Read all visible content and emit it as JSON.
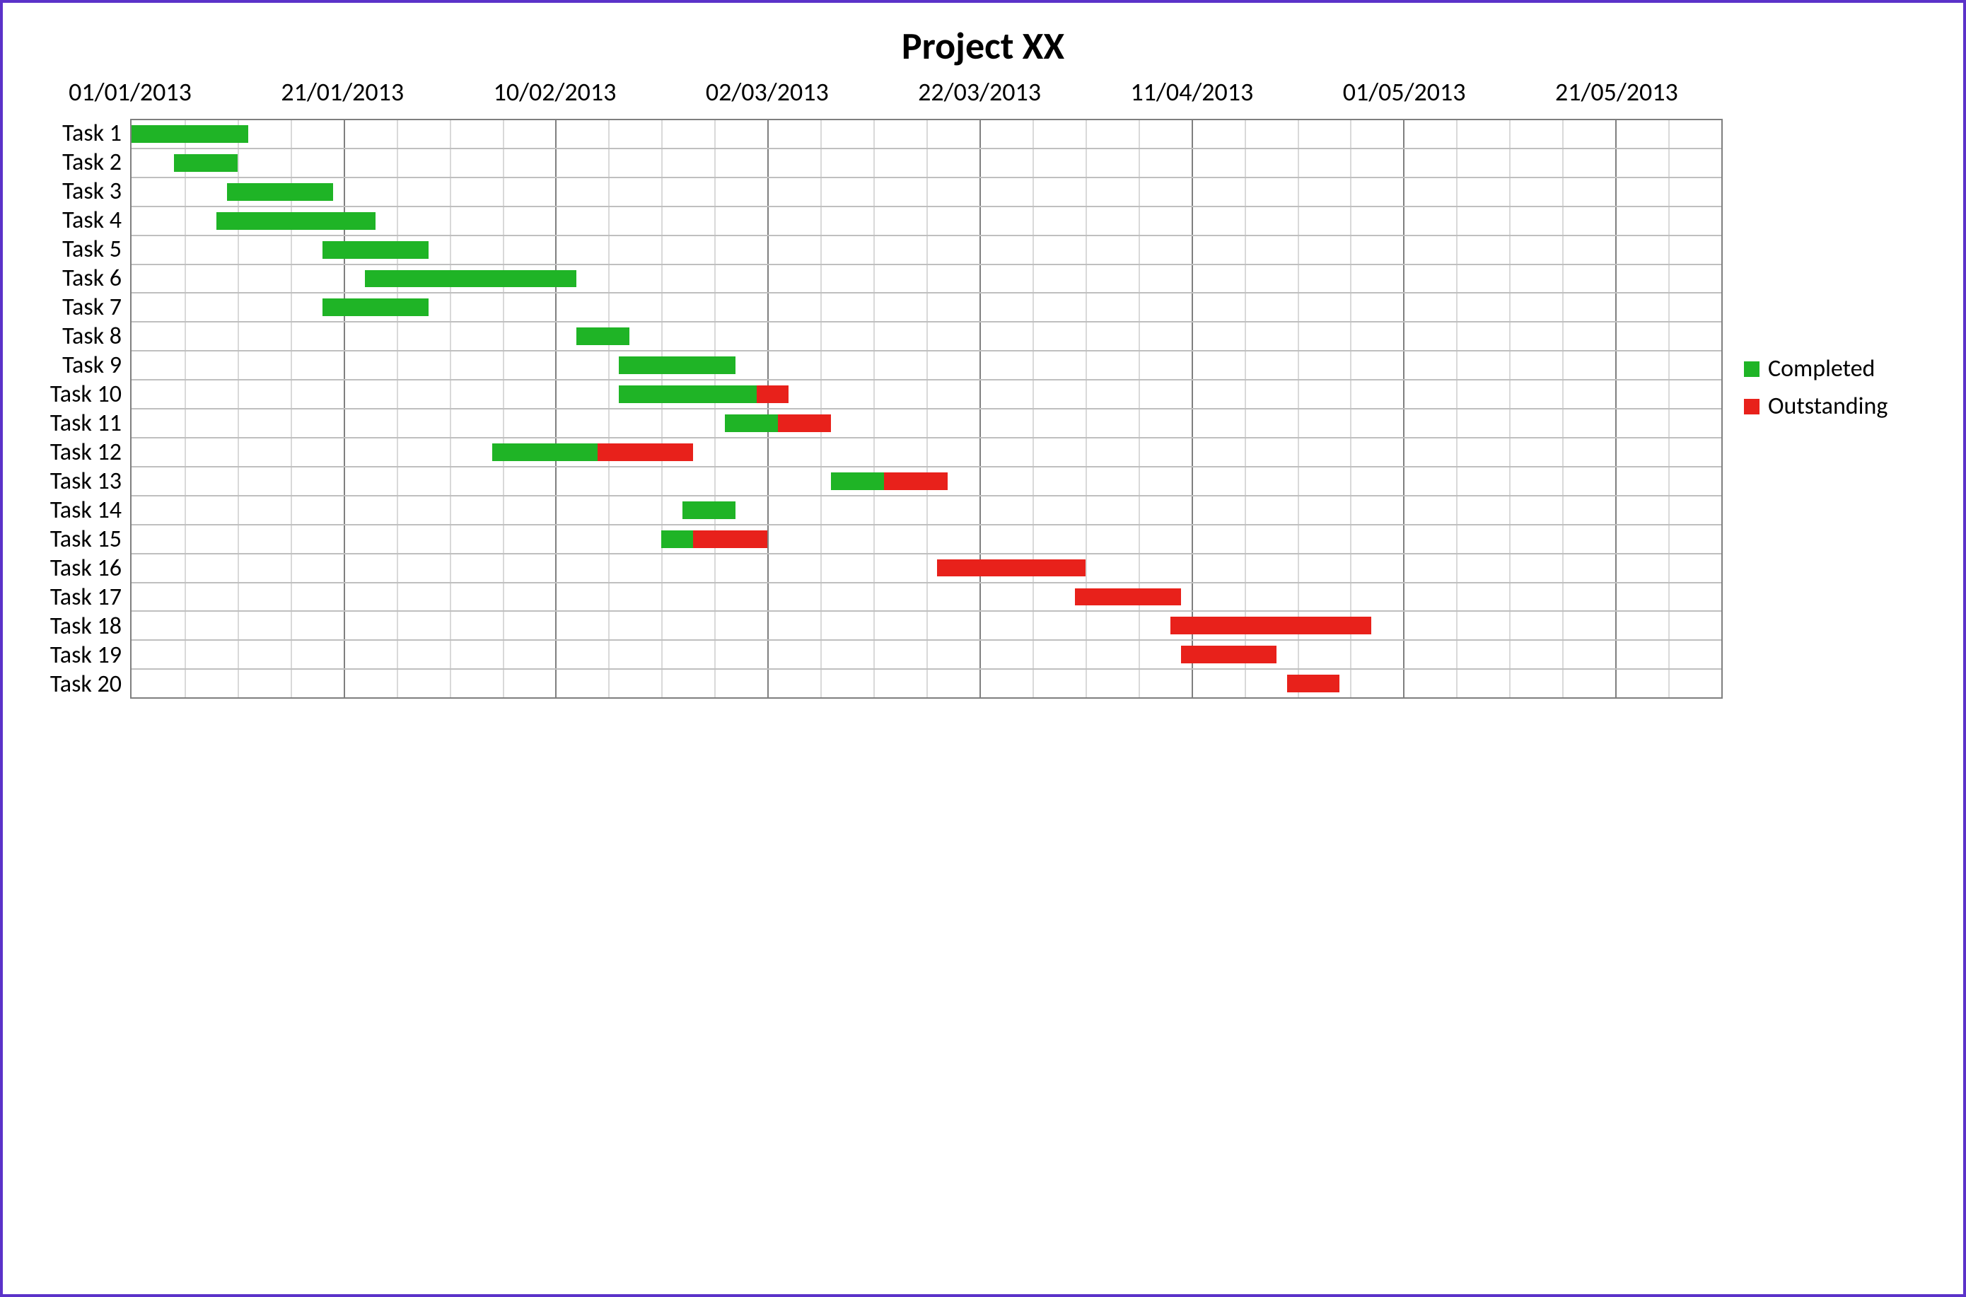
{
  "title": "Project XX",
  "legend": {
    "completed": "Completed",
    "outstanding": "Outstanding"
  },
  "colors": {
    "completed": "#1fb426",
    "outstanding": "#e8211b",
    "grid_major": "#7f7f7f",
    "grid_minor": "#d9d9d9"
  },
  "chart_data": {
    "type": "bar",
    "orientation": "horizontal-stacked-gantt",
    "x_origin": "01/01/2013",
    "x_unit": "days",
    "x_ticks_days": [
      0,
      20,
      40,
      60,
      80,
      100,
      120,
      140
    ],
    "x_tick_labels": [
      "01/01/2013",
      "21/01/2013",
      "10/02/2013",
      "02/03/2013",
      "22/03/2013",
      "11/04/2013",
      "01/05/2013",
      "21/05/2013"
    ],
    "minor_gridline_interval_days": 5,
    "xlim": [
      0,
      150
    ],
    "tasks": [
      {
        "name": "Task 1",
        "start": 0,
        "completed": 11,
        "outstanding": 0
      },
      {
        "name": "Task 2",
        "start": 4,
        "completed": 6,
        "outstanding": 0
      },
      {
        "name": "Task 3",
        "start": 9,
        "completed": 10,
        "outstanding": 0
      },
      {
        "name": "Task 4",
        "start": 8,
        "completed": 15,
        "outstanding": 0
      },
      {
        "name": "Task 5",
        "start": 18,
        "completed": 10,
        "outstanding": 0
      },
      {
        "name": "Task 6",
        "start": 22,
        "completed": 20,
        "outstanding": 0
      },
      {
        "name": "Task 7",
        "start": 18,
        "completed": 10,
        "outstanding": 0
      },
      {
        "name": "Task 8",
        "start": 42,
        "completed": 5,
        "outstanding": 0
      },
      {
        "name": "Task 9",
        "start": 46,
        "completed": 11,
        "outstanding": 0
      },
      {
        "name": "Task 10",
        "start": 46,
        "completed": 13,
        "outstanding": 3
      },
      {
        "name": "Task 11",
        "start": 56,
        "completed": 5,
        "outstanding": 5
      },
      {
        "name": "Task 12",
        "start": 34,
        "completed": 10,
        "outstanding": 9
      },
      {
        "name": "Task 13",
        "start": 66,
        "completed": 5,
        "outstanding": 6
      },
      {
        "name": "Task 14",
        "start": 52,
        "completed": 5,
        "outstanding": 0
      },
      {
        "name": "Task 15",
        "start": 50,
        "completed": 3,
        "outstanding": 7
      },
      {
        "name": "Task 16",
        "start": 76,
        "completed": 0,
        "outstanding": 14
      },
      {
        "name": "Task 17",
        "start": 89,
        "completed": 0,
        "outstanding": 10
      },
      {
        "name": "Task 18",
        "start": 98,
        "completed": 0,
        "outstanding": 19
      },
      {
        "name": "Task 19",
        "start": 99,
        "completed": 0,
        "outstanding": 9
      },
      {
        "name": "Task 20",
        "start": 109,
        "completed": 0,
        "outstanding": 5
      }
    ]
  }
}
